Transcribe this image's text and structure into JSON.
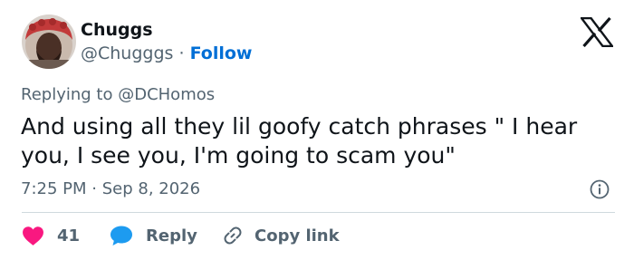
{
  "author": {
    "name": "Chuggs",
    "handle": "@Chugggs",
    "separator": "·",
    "follow_label": "Follow"
  },
  "reply_context": {
    "prefix": "Replying to",
    "mention": "@DCHomos"
  },
  "tweet": {
    "lines": [
      "And using all they lil goofy catch phrases \" I hear",
      "you, I see you, I'm going to scam you\""
    ]
  },
  "meta": {
    "time": "7:25 PM",
    "separator": "·",
    "date": "Sep 8, 2026"
  },
  "actions": {
    "like_count": "41",
    "reply_label": "Reply",
    "copy_label": "Copy link"
  },
  "icons": {
    "brand": "x-logo-icon",
    "info": "info-icon",
    "like": "heart-icon",
    "reply": "speech-bubble-icon",
    "copy": "link-icon"
  },
  "colors": {
    "text": "#0f1419",
    "muted": "#536471",
    "follow": "#006fd6",
    "like": "#f91880",
    "reply": "#1d9bf0",
    "divider": "#cfd9de"
  }
}
